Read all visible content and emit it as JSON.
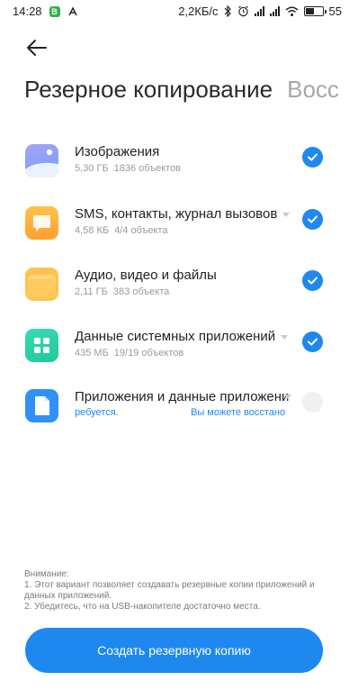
{
  "status_bar": {
    "time": "14:28",
    "speed": "2,2КБ/с",
    "battery": "55",
    "battery_level": 0.55
  },
  "header": {
    "back_icon": "arrow-left-icon",
    "tab_active": "Резерное копирование",
    "tab_inactive": "Восс"
  },
  "items": [
    {
      "name": "Изображения",
      "size": "5,30 ГБ",
      "count": "1836 объектов",
      "checked": true,
      "icon": "image-icon",
      "color": "#8e97f5"
    },
    {
      "name": "SMS, контакты, журнал вызовов",
      "size": "4,58 КБ",
      "count": "4/4 объекта",
      "checked": true,
      "icon": "message-icon",
      "color": "#ffb43b"
    },
    {
      "name": "Аудио, видео и файлы",
      "size": "2,11 ГБ",
      "count": "383 объекта",
      "checked": true,
      "icon": "folder-icon",
      "color": "#ffc24d"
    },
    {
      "name": "Данные системных приложений",
      "size": "435 МБ",
      "count": "19/19 объектов",
      "checked": true,
      "icon": "apps-icon",
      "color": "#2fd4a8"
    },
    {
      "name": "Приложения и данные приложени",
      "status": "ребуется.",
      "restore": "Вы можете восстано",
      "checked": false,
      "icon": "file-icon",
      "color": "#2f90f5"
    }
  ],
  "note": {
    "title": "Внимание:",
    "line1": "1. Этот вариант позволяет создавать резервные копии приложений и данных приложений.",
    "line2": "2. Убедитесь, что на USB-накопителе достаточно места."
  },
  "cta_label": "Создать резервную копию",
  "accent": "#1e88ef"
}
